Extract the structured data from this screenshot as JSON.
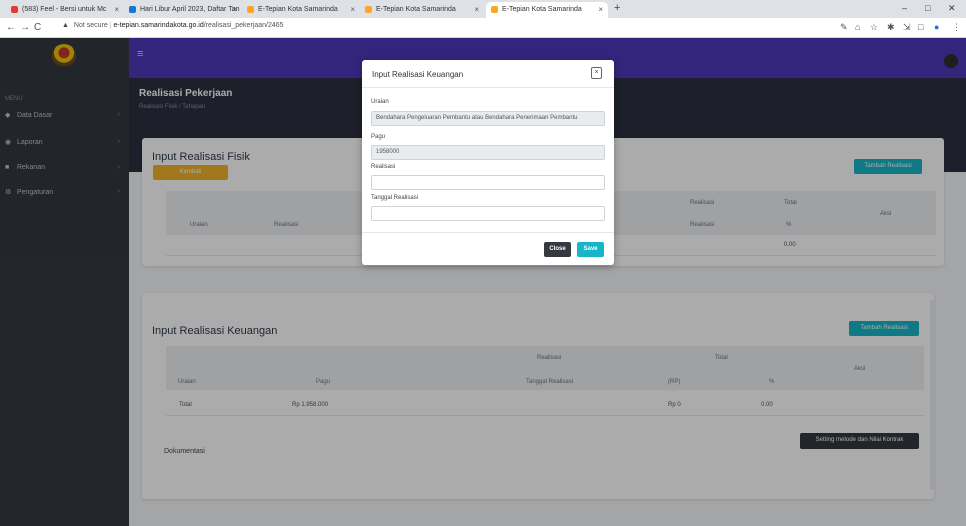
{
  "browser": {
    "tabs": [
      {
        "label": "(583) Feel - Bersi untuk Mc",
        "color": "#e53935"
      },
      {
        "label": "Hari Libur April 2023, Daftar Tan",
        "color": "#1976d2"
      },
      {
        "label": "E-Tepian Kota Samarinda",
        "color": "#f9a825"
      },
      {
        "label": "E-Tepian Kota Samarinda",
        "color": "#f9a825"
      },
      {
        "label": "E-Tepian Kota Samarinda",
        "color": "#f9a825"
      }
    ],
    "tab_close": "×",
    "new_tab": "+",
    "window_controls": {
      "minimize": "–",
      "maximize": "□",
      "close": "✕"
    },
    "back": "←",
    "forward": "→",
    "reload": "C",
    "security_label": "Not secure",
    "url_host": "e-tepian.samarindakota.go.id",
    "url_path": "/realisasi_pekerjaan/2465",
    "extensions": [
      "✎",
      "⌂",
      "☆",
      "✱",
      "⇲",
      "□",
      "●",
      "⋮"
    ]
  },
  "sidebar": {
    "header": "MENU",
    "items": [
      {
        "icon": "◆",
        "label": "Data Dasar",
        "caret": "›"
      },
      {
        "icon": "◉",
        "label": "Laporan",
        "caret": "›"
      },
      {
        "icon": "■",
        "label": "Rekanan",
        "caret": "›"
      },
      {
        "icon": "⚙",
        "label": "Pengaturan",
        "caret": "›"
      }
    ]
  },
  "topbar": {
    "menu_icon": "≡"
  },
  "page": {
    "title": "Realisasi Pekerjaan",
    "subtitle": "Realisasi Fisik / Tahapan"
  },
  "fisik": {
    "title": "Input Realisasi Fisik",
    "back_label": "Kembali",
    "add_label": "Tambah Realisasi",
    "headers": {
      "uraian": "Uraian",
      "realisasi": "Realisasi",
      "realisasi_group": "Realisasi",
      "total": "Total",
      "realisasi_sub": "Realisasi",
      "pct": "%",
      "aksi": "Aksi"
    },
    "total_pct": "0.00"
  },
  "keuangan": {
    "title": "Input Realisasi Keuangan",
    "add_label": "Tambah Realisasi",
    "group_header": "Realisasi",
    "total_header": "Total",
    "headers": {
      "uraian": "Uraian",
      "pagu": "Pagu",
      "tanggal": "Tanggal Realisasi",
      "rp": "(RP)",
      "pct": "%",
      "aksi": "Aksi"
    },
    "row": {
      "uraian": "Total",
      "pagu": "Rp 1.958.000",
      "rp": "Rp 0",
      "pct": "0.00"
    },
    "dokumentasi": "Dokumentasi",
    "setting_label": "Setting metode dan Nilai Kontrak"
  },
  "modal": {
    "title": "Input Realisasi Keuangan",
    "close_icon": "×",
    "uraian_label": "Uraian",
    "uraian_value": "Bendahara Pengeluaran Pembantu atau Bendahara Penerimaan Pembantu",
    "pagu_label": "Pagu",
    "pagu_value": "1958000",
    "realisasi_label": "Realisasi",
    "realisasi_value": "",
    "tanggal_label": "Tanggal Realisasi",
    "tanggal_value": "",
    "close_label": "Close",
    "save_label": "Save"
  }
}
